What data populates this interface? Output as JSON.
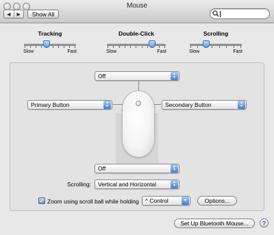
{
  "window": {
    "title": "Mouse"
  },
  "toolbar": {
    "back_glyph": "◀",
    "forward_glyph": "▶",
    "show_all_label": "Show All",
    "search_placeholder": ""
  },
  "sliders": [
    {
      "title": "Tracking",
      "min_label": "Slow",
      "max_label": "Fast",
      "tick_count": 10,
      "value_fraction": 0.44
    },
    {
      "title": "Double-Click",
      "min_label": "Slow",
      "max_label": "Fast",
      "tick_count": 11,
      "value_fraction": 0.75
    },
    {
      "title": "Scrolling",
      "min_label": "Slow",
      "max_label": "Fast",
      "tick_count": 8,
      "value_fraction": 0.33
    }
  ],
  "mouse_config": {
    "top_popup_value": "Off",
    "left_popup_value": "Primary Button",
    "right_popup_value": "Secondary Button",
    "bottom_popup_value": "Off",
    "scrolling_label": "Scrolling:",
    "scrolling_value": "Vertical and Horizontal",
    "zoom_checkbox_label": "Zoom using scroll ball while holding",
    "zoom_checked": true,
    "zoom_modifier_value": "^ Control",
    "options_button_label": "Options...",
    "apple_glyph": ""
  },
  "footer": {
    "bluetooth_button_label": "Set Up Bluetooth Mouse...",
    "help_glyph": "?"
  },
  "colors": {
    "accent": "#3f7fd6",
    "window_bg": "#e8e8e8"
  }
}
